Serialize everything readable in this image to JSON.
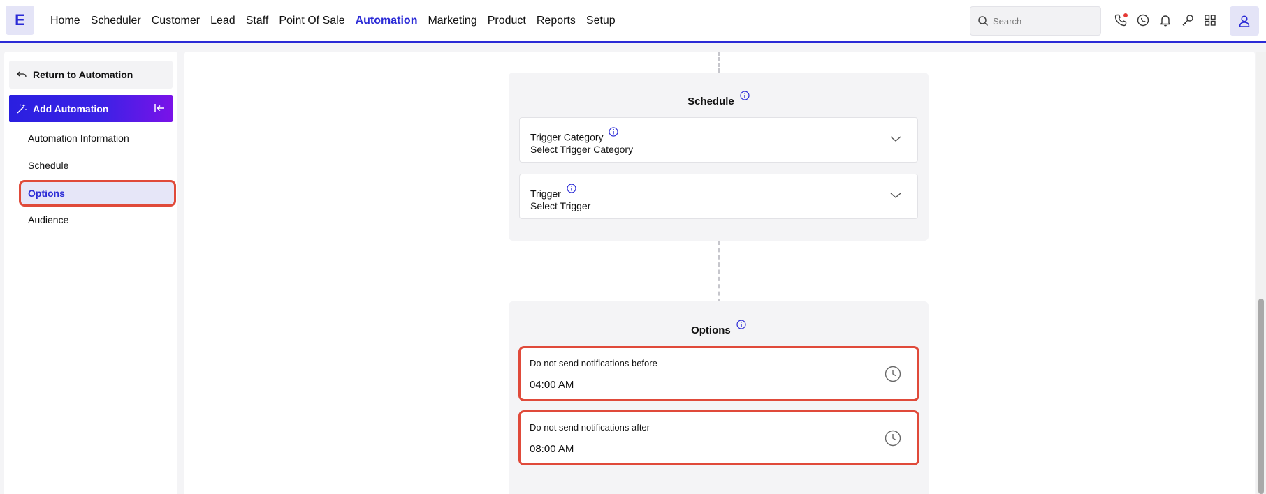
{
  "header": {
    "logo_letter": "E",
    "nav": [
      "Home",
      "Scheduler",
      "Customer",
      "Lead",
      "Staff",
      "Point Of Sale",
      "Automation",
      "Marketing",
      "Product",
      "Reports",
      "Setup"
    ],
    "active_nav": "Automation",
    "search": {
      "placeholder": "Search"
    },
    "icons": [
      "phone-icon",
      "whatsapp-icon",
      "bell-icon",
      "key-icon",
      "apps-grid-icon"
    ],
    "accent_color": "#2b2bd6"
  },
  "sidebar": {
    "return_label": "Return to Automation",
    "add_label": "Add Automation",
    "items": [
      "Automation Information",
      "Schedule",
      "Options",
      "Audience"
    ],
    "active_item": "Options"
  },
  "schedule": {
    "title": "Schedule",
    "trigger_category": {
      "label": "Trigger Category",
      "value": "Select Trigger Category"
    },
    "trigger": {
      "label": "Trigger",
      "value": "Select Trigger"
    }
  },
  "options": {
    "title": "Options",
    "before": {
      "label": "Do not send notifications before",
      "value": "04:00 AM"
    },
    "after": {
      "label": "Do not send notifications after",
      "value": "08:00 AM"
    }
  }
}
